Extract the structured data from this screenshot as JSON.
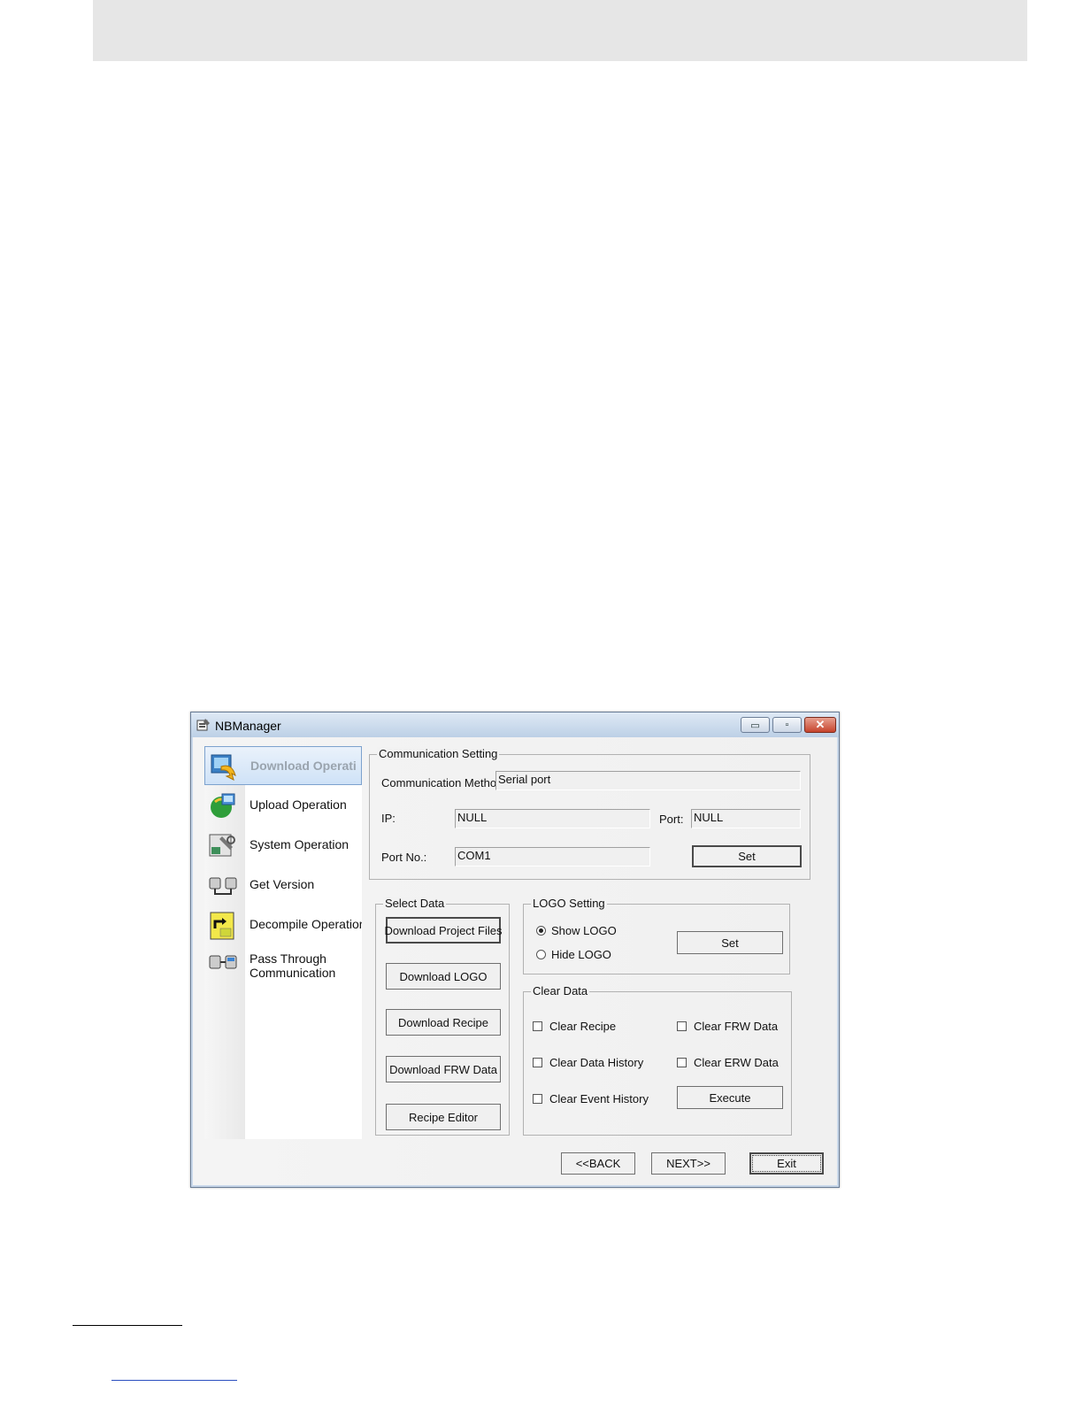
{
  "window": {
    "title": "NBManager"
  },
  "window_controls": {
    "minimize": "▭",
    "restore": "▫",
    "close": "✕"
  },
  "sidebar": {
    "items": [
      {
        "label": "Download Operati",
        "icon": "download-operation-icon"
      },
      {
        "label": "Upload Operation",
        "icon": "upload-operation-icon"
      },
      {
        "label": "System Operation",
        "icon": "system-operation-icon"
      },
      {
        "label": "Get Version",
        "icon": "get-version-icon"
      },
      {
        "label": "Decompile Operation",
        "icon": "decompile-operation-icon"
      },
      {
        "label": "Pass Through",
        "label2": "Communication",
        "icon": "pass-through-communication-icon"
      }
    ]
  },
  "communication": {
    "title": "Communication Setting",
    "method_label": "Communication Method:",
    "method_value": "Serial port",
    "ip_label": "IP:",
    "ip_value": "NULL",
    "port_label": "Port:",
    "port_value": "NULL",
    "portno_label": "Port No.:",
    "portno_value": "COM1",
    "set_label": "Set"
  },
  "select_data": {
    "title": "Select Data",
    "buttons": [
      "Download Project Files",
      "Download LOGO",
      "Download Recipe",
      "Download FRW Data",
      "Recipe Editor"
    ]
  },
  "logo": {
    "title": "LOGO Setting",
    "show_label": "Show LOGO",
    "hide_label": "Hide LOGO",
    "selected": "Show LOGO",
    "set_label": "Set"
  },
  "clear": {
    "title": "Clear Data",
    "recipe": "Clear Recipe",
    "frw": "Clear FRW Data",
    "data_history": "Clear Data History",
    "erw": "Clear ERW Data",
    "event_history": "Clear Event History",
    "execute_label": "Execute"
  },
  "footer": {
    "back": "<<BACK",
    "next": "NEXT>>",
    "exit": "Exit"
  }
}
